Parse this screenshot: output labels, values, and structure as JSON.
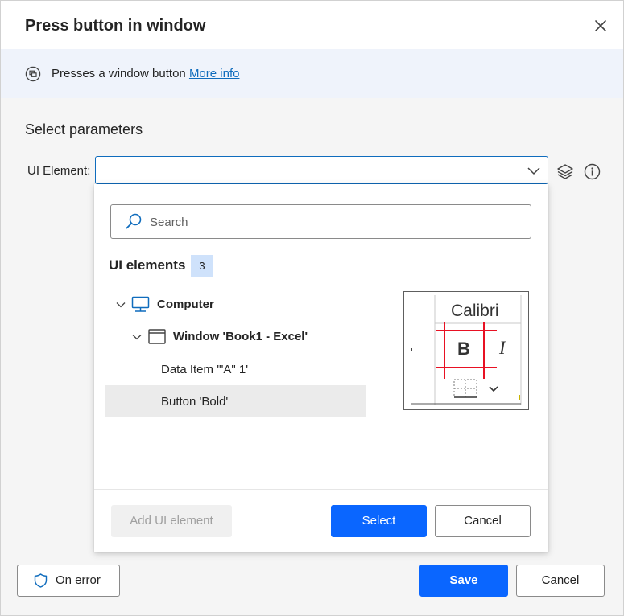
{
  "dialog": {
    "title": "Press button in window"
  },
  "info_bar": {
    "text": "Presses a window button",
    "link": "More info"
  },
  "parameters": {
    "section_title": "Select parameters",
    "ui_element_label": "UI Element:",
    "ui_element_value": ""
  },
  "dropdown": {
    "search_placeholder": "Search",
    "heading": "UI elements",
    "count": "3",
    "tree": [
      {
        "label": "Computer",
        "icon": "computer-icon",
        "expanded": true
      },
      {
        "label": "Window 'Book1 - Excel'",
        "icon": "window-icon",
        "expanded": true
      },
      {
        "label": "Data Item '\"A\" 1'"
      },
      {
        "label": "Button 'Bold'",
        "selected": true
      }
    ],
    "preview": {
      "font_name": "Calibri",
      "bold_glyph": "B",
      "italic_glyph": "I"
    },
    "add_button": "Add UI element",
    "select_button": "Select",
    "cancel_button": "Cancel"
  },
  "footer": {
    "on_error": "On error",
    "save": "Save",
    "cancel": "Cancel"
  },
  "colors": {
    "primary": "#0a66ff",
    "link": "#0f6cbd",
    "info_bg": "#eff3fb",
    "badge_bg": "#cfe2fb",
    "selection_bg": "#ebebeb",
    "highlight_red": "#e81123"
  }
}
